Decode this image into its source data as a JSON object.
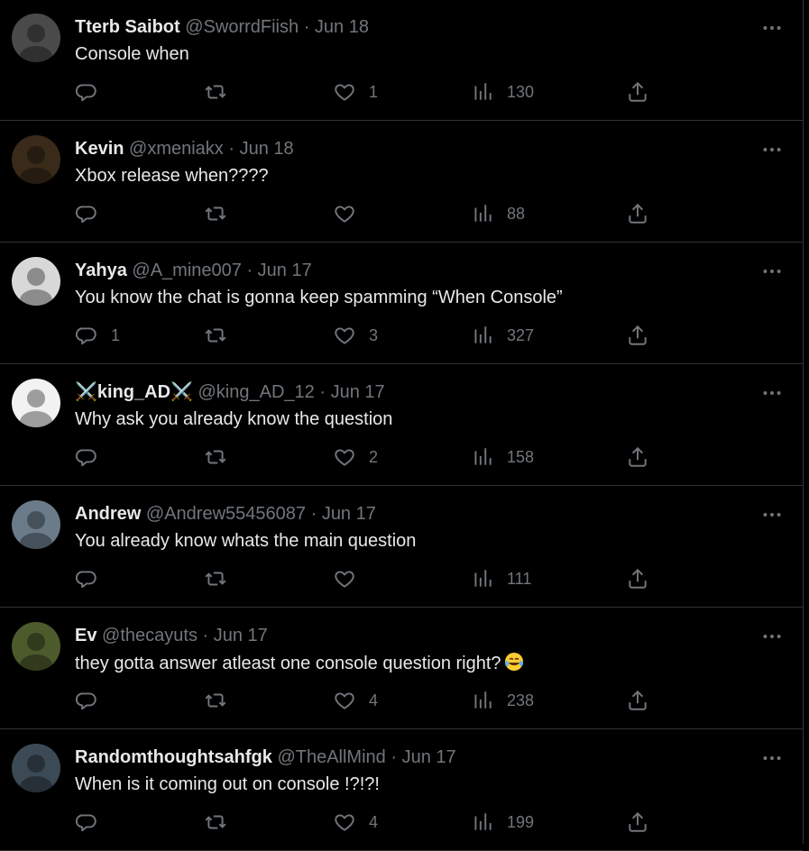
{
  "tweets": [
    {
      "name": "Tterb Saibot",
      "handle": "@SworrdFiish",
      "sep": "·",
      "date": "Jun 18",
      "text": "Console when",
      "replies": "",
      "retweets": "",
      "likes": "1",
      "views": "130",
      "avatar_color": "#4a4a4a"
    },
    {
      "name": "Kevin",
      "handle": "@xmeniakx",
      "sep": "·",
      "date": "Jun 18",
      "text": "Xbox release when????",
      "replies": "",
      "retweets": "",
      "likes": "",
      "views": "88",
      "avatar_color": "#3a2a1a"
    },
    {
      "name": "Yahya",
      "handle": "@A_mine007",
      "sep": "·",
      "date": "Jun 17",
      "text": "You know the chat is gonna keep spamming “When Console”",
      "replies": "1",
      "retweets": "",
      "likes": "3",
      "views": "327",
      "avatar_color": "#d8d8d8"
    },
    {
      "name": "⚔️king_AD⚔️",
      "handle": "@king_AD_12",
      "sep": "·",
      "date": "Jun 17",
      "text": "Why ask you already know the question",
      "replies": "",
      "retweets": "",
      "likes": "2",
      "views": "158",
      "avatar_color": "#f2f2f2"
    },
    {
      "name": "Andrew",
      "handle": "@Andrew55456087",
      "sep": "·",
      "date": "Jun 17",
      "text": "You already know whats the main question",
      "replies": "",
      "retweets": "",
      "likes": "",
      "views": "111",
      "avatar_color": "#6b7b8a"
    },
    {
      "name": "Ev",
      "handle": "@thecayuts",
      "sep": "·",
      "date": "Jun 17",
      "text": "they gotta answer atleast one console question right?",
      "replies": "",
      "retweets": "",
      "likes": "4",
      "views": "238",
      "avatar_color": "#4c5a2c",
      "emoji": "face-with-tears-of-joy"
    },
    {
      "name": "Randomthoughtsahfgk",
      "handle": "@TheAllMind",
      "sep": "·",
      "date": "Jun 17",
      "text": "When is it coming out on console !?!?!",
      "replies": "",
      "retweets": "",
      "likes": "4",
      "views": "199",
      "avatar_color": "#3c4a55"
    }
  ],
  "colors": {
    "background": "#000000",
    "text": "#e7e9ea",
    "muted": "#71767b",
    "border": "#2f3336"
  },
  "icons": [
    "reply-icon",
    "retweet-icon",
    "like-icon",
    "views-icon",
    "share-icon",
    "more-icon"
  ]
}
